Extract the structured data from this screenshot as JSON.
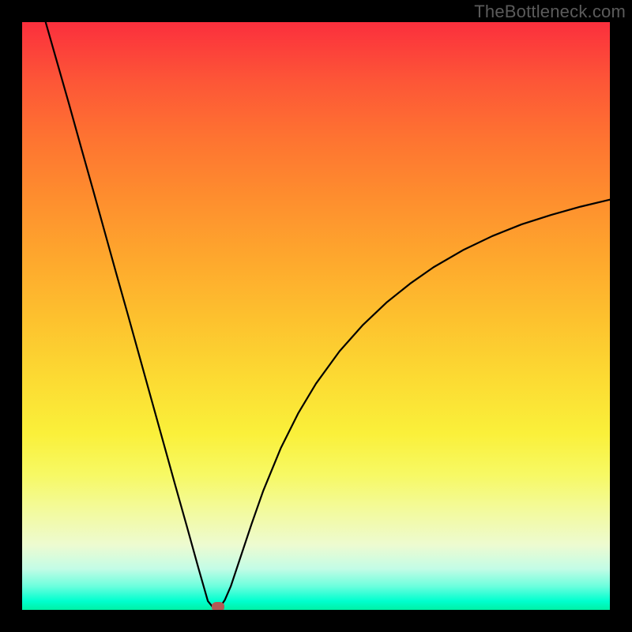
{
  "watermark": "TheBottleneck.com",
  "chart_data": {
    "type": "line",
    "title": "",
    "xlabel": "",
    "ylabel": "",
    "xlim": [
      0,
      100
    ],
    "ylim": [
      0,
      100
    ],
    "grid": false,
    "legend": false,
    "gradient_colors": {
      "top": "#fb2f3d",
      "mid_upper": "#fe8e2e",
      "mid": "#fcd932",
      "mid_lower": "#f7f964",
      "bottom": "#00ffcf"
    },
    "series": [
      {
        "name": "bottleneck-curve",
        "color": "#000000",
        "x": [
          4.0,
          6.0,
          8.0,
          10.0,
          12.0,
          14.0,
          16.0,
          18.0,
          20.0,
          22.0,
          24.0,
          26.0,
          28.0,
          30.0,
          31.6,
          32.5,
          33.1,
          33.7,
          34.5,
          35.5,
          37.0,
          39.0,
          41.0,
          44.0,
          47.0,
          50.0,
          54.0,
          58.0,
          62.0,
          66.0,
          70.0,
          75.0,
          80.0,
          85.0,
          90.0,
          95.0,
          100.0
        ],
        "y": [
          100.0,
          93.0,
          86.0,
          78.8,
          71.7,
          64.5,
          57.3,
          50.2,
          43.0,
          35.8,
          28.6,
          21.4,
          14.3,
          7.1,
          1.5,
          0.4,
          0.2,
          0.5,
          1.7,
          4.0,
          8.5,
          14.5,
          20.2,
          27.5,
          33.5,
          38.5,
          44.0,
          48.5,
          52.3,
          55.5,
          58.3,
          61.2,
          63.6,
          65.6,
          67.2,
          68.6,
          69.8
        ]
      }
    ],
    "annotations": [
      {
        "name": "minimum-marker",
        "x": 33.4,
        "y": 0.6,
        "color": "#b25a55"
      }
    ]
  }
}
